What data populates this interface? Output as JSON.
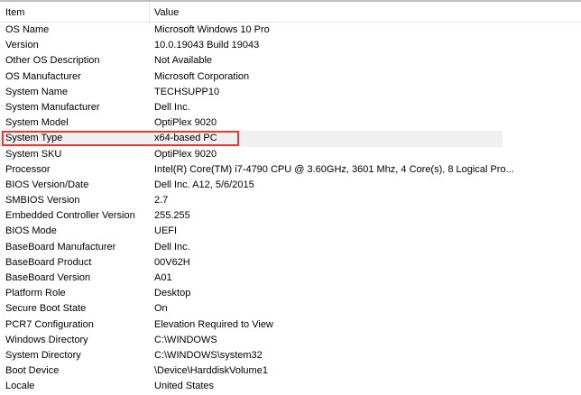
{
  "header": {
    "item": "Item",
    "value": "Value"
  },
  "rows": [
    {
      "item": "OS Name",
      "value": "Microsoft Windows 10 Pro"
    },
    {
      "item": "Version",
      "value": "10.0.19043 Build 19043"
    },
    {
      "item": "Other OS Description",
      "value": "Not Available"
    },
    {
      "item": "OS Manufacturer",
      "value": "Microsoft Corporation"
    },
    {
      "item": "System Name",
      "value": "TECHSUPP10"
    },
    {
      "item": "System Manufacturer",
      "value": "Dell Inc."
    },
    {
      "item": "System Model",
      "value": "OptiPlex 9020"
    },
    {
      "item": "System Type",
      "value": "x64-based PC"
    },
    {
      "item": "System SKU",
      "value": "OptiPlex 9020"
    },
    {
      "item": "Processor",
      "value": "Intel(R) Core(TM) i7-4790 CPU @ 3.60GHz, 3601 Mhz, 4 Core(s), 8 Logical Pro..."
    },
    {
      "item": "BIOS Version/Date",
      "value": "Dell Inc. A12, 5/6/2015"
    },
    {
      "item": "SMBIOS Version",
      "value": "2.7"
    },
    {
      "item": "Embedded Controller Version",
      "value": "255.255"
    },
    {
      "item": "BIOS Mode",
      "value": "UEFI"
    },
    {
      "item": "BaseBoard Manufacturer",
      "value": "Dell Inc."
    },
    {
      "item": "BaseBoard Product",
      "value": "00V62H"
    },
    {
      "item": "BaseBoard Version",
      "value": "A01"
    },
    {
      "item": "Platform Role",
      "value": "Desktop"
    },
    {
      "item": "Secure Boot State",
      "value": "On"
    },
    {
      "item": "PCR7 Configuration",
      "value": "Elevation Required to View"
    },
    {
      "item": "Windows Directory",
      "value": "C:\\WINDOWS"
    },
    {
      "item": "System Directory",
      "value": "C:\\WINDOWS\\system32"
    },
    {
      "item": "Boot Device",
      "value": "\\Device\\HarddiskVolume1"
    },
    {
      "item": "Locale",
      "value": "United States"
    }
  ],
  "selected_index": 7,
  "colors": {
    "highlight": "#e53935",
    "selection": "#f0f0f0"
  }
}
